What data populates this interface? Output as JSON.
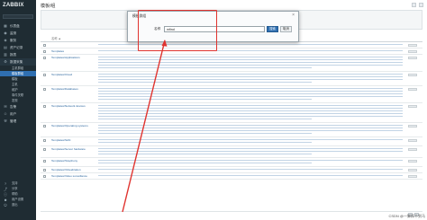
{
  "app": {
    "logo": "ZABBIX",
    "logo_sub": ""
  },
  "page": {
    "title": "模板/组"
  },
  "sidebar": {
    "items": [
      {
        "label": "仪表盘",
        "icon": "dashboard-icon"
      },
      {
        "label": "监测",
        "icon": "monitoring-icon"
      },
      {
        "label": "服务",
        "icon": "services-icon"
      },
      {
        "label": "资产记录",
        "icon": "inventory-icon"
      },
      {
        "label": "报表",
        "icon": "reports-icon"
      },
      {
        "label": "数据采集",
        "icon": "data-collection-icon"
      }
    ],
    "subitems": [
      "主机群组",
      "模板群组",
      "模板",
      "主机",
      "维护",
      "事件关联",
      "发现"
    ],
    "bottom_items": [
      {
        "label": "告警",
        "icon": "alerts-icon"
      },
      {
        "label": "用户",
        "icon": "users-icon"
      },
      {
        "label": "管理",
        "icon": "admin-icon"
      }
    ],
    "footer_items": [
      {
        "label": "支持",
        "icon": "support-icon"
      },
      {
        "label": "分享",
        "icon": "share-icon"
      },
      {
        "label": "帮助",
        "icon": "help-icon"
      },
      {
        "label": "用户设置",
        "icon": "user-settings-icon"
      },
      {
        "label": "退出",
        "icon": "logout-icon"
      }
    ]
  },
  "table": {
    "header_name": "名称 ▲",
    "rows": [
      {
        "name": "",
        "lines": 1
      },
      {
        "name": "Templates",
        "lines": 1
      },
      {
        "name": "Templates/Applications",
        "lines": 5
      },
      {
        "name": "Templates/Cloud",
        "lines": 4
      },
      {
        "name": "Templates/Databases",
        "lines": 5
      },
      {
        "name": "Templates/Network devices",
        "lines": 6
      },
      {
        "name": "Templates/Operating systems",
        "lines": 4
      },
      {
        "name": "Templates/SAN",
        "lines": 2
      },
      {
        "name": "Templates/Server hardware",
        "lines": 3
      },
      {
        "name": "Templates/Telephony",
        "lines": 2
      },
      {
        "name": "Templates/Virtualization",
        "lines": 1
      },
      {
        "name": "Templates/Video surveillance",
        "lines": 1
      }
    ]
  },
  "modal": {
    "title": "模板群组",
    "field_label": "名称",
    "field_value": "mfind",
    "search_button": "搜索",
    "cancel_button": "取消",
    "close_glyph": "×"
  },
  "annotation": {
    "highlight_color": "#e0332f"
  },
  "watermark": "CSDN @一脚踩不到马"
}
